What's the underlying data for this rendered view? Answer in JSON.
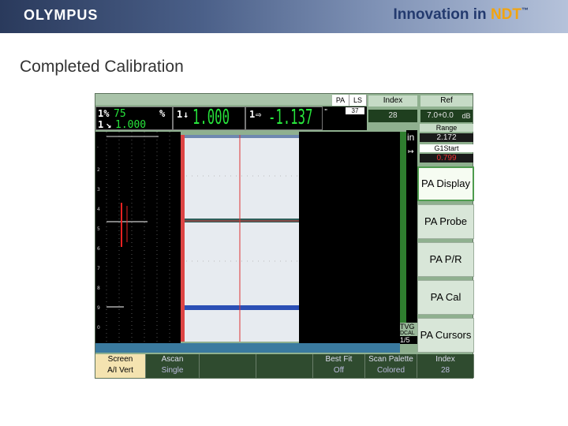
{
  "header": {
    "logo": "OLYMPUS",
    "tagline_prefix": "Innovation in ",
    "tagline_brand": "NDT",
    "tm": "™"
  },
  "slide_title": "Completed Calibration",
  "device": {
    "tabs": [
      "PA",
      "LS"
    ],
    "readouts": {
      "pct_label": "1%",
      "pct_value": "75",
      "pct_unit": "%",
      "gain_label": "1",
      "gain_value": "1.000",
      "gate1_label": "1",
      "gate1_value": "1.000",
      "gate2_label": "1",
      "gate2_value": "-1.137",
      "inch": "in"
    },
    "small_box": "37",
    "index_header": "Index",
    "index_value": "28",
    "ref_header": "Ref",
    "ref_value": "7.0+0.0",
    "ref_unit": "dB",
    "range_label": "Range",
    "range_value": "2.172",
    "g1start_label": "G1Start",
    "g1start_value": "0.799",
    "menu": [
      {
        "label": "PA Display",
        "selected": true
      },
      {
        "label": "PA Probe",
        "selected": false
      },
      {
        "label": "PA P/R",
        "selected": false
      },
      {
        "label": "PA Cal",
        "selected": false
      },
      {
        "label": "PA Cursors",
        "selected": false
      }
    ],
    "tvg": "TVG",
    "dcal": "DCAL",
    "page": "1/5",
    "footer": [
      {
        "top": "Screen",
        "bottom": "A/I  Vert",
        "selected": true
      },
      {
        "top": "Ascan",
        "bottom": "Single",
        "selected": false
      },
      {
        "top": "",
        "bottom": "",
        "selected": false
      },
      {
        "top": "",
        "bottom": "",
        "selected": false
      },
      {
        "top": "Best Fit",
        "bottom": "Off",
        "selected": false
      },
      {
        "top": "Scan Palette",
        "bottom": "Colored",
        "selected": false
      },
      {
        "top": "Index",
        "bottom": "28",
        "selected": false
      }
    ]
  }
}
